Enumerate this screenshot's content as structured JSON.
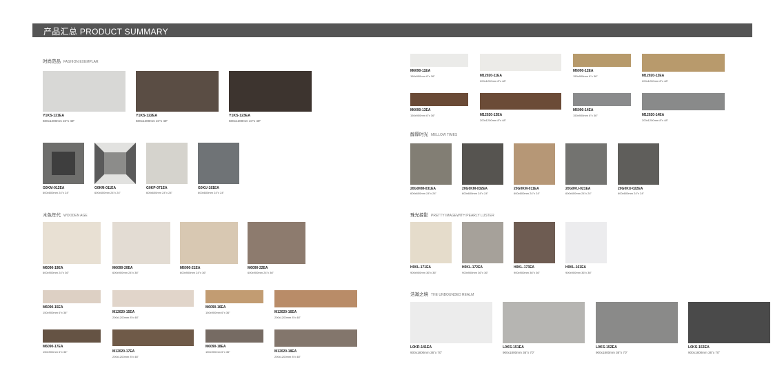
{
  "header": {
    "title": "产品汇总 PRODUCT SUMMARY"
  },
  "sections": {
    "fashion": {
      "cn": "时尚范品",
      "en": "FASHION EXEMPLAR"
    },
    "wooden": {
      "cn": "木色年代",
      "en": "WOODEN AGE"
    },
    "mellow": {
      "cn": "醇厚时光",
      "en": "MELLOW TIMES"
    },
    "pearly": {
      "cn": "珠光掠影",
      "en": "PRETTY IMAGEWITH PEARLY LUSTER"
    },
    "realm": {
      "cn": "浩瀚之境",
      "en": "THE UNBOUNDED REALM"
    }
  },
  "tiles": [
    {
      "code": "Y1KS-121EA",
      "size": "600x1200mm 24\"x 48\"",
      "color": "#d8d8d6"
    },
    {
      "code": "Y1KS-122EA",
      "size": "600x1200mm 24\"x 48\"",
      "color": "#5a4d44"
    },
    {
      "code": "Y1KS-123EA",
      "size": "600x1200mm 24\"x 48\"",
      "color": "#3d342f"
    },
    {
      "code": "G0KM-012EA",
      "size": "600x600mm 24\"x 24\"",
      "color": "#6e6e6c"
    },
    {
      "code": "G0KM-011EA",
      "size": "600x600mm 24\"x 24\"",
      "color": "#8c8c8a"
    },
    {
      "code": "G0KP-071EA",
      "size": "600x600mm 24\"x 24\"",
      "color": "#d5d3cd"
    },
    {
      "code": "G0KU-181EA",
      "size": "600x600mm 24\"x 24\"",
      "color": "#6f7376"
    },
    {
      "code": "M6090-19EA",
      "size": "600x900mm 24\"x 36\"",
      "color": "#e8e0d3"
    },
    {
      "code": "M6090-20EA",
      "size": "600x900mm 24\"x 36\"",
      "color": "#e3dcd3"
    },
    {
      "code": "M6090-21EA",
      "size": "600x900mm 24\"x 36\"",
      "color": "#d8c8b2"
    },
    {
      "code": "M6090-22EA",
      "size": "600x900mm 24\"x 36\"",
      "color": "#8d7b6e"
    },
    {
      "code": "M6090-15EA",
      "size": "150x900mm 6\"x 36\"",
      "color": "#ddd0c4"
    },
    {
      "code": "M12020-15EA",
      "size": "200x1200mm 8\"x 48\"",
      "color": "#e1d5ca"
    },
    {
      "code": "M6090-16EA",
      "size": "150x900mm 6\"x 36\"",
      "color": "#c29c72"
    },
    {
      "code": "M12020-16EA",
      "size": "200x1200mm 8\"x 48\"",
      "color": "#b98c68"
    },
    {
      "code": "M6090-17EA",
      "size": "150x900mm 6\"x 36\"",
      "color": "#655344"
    },
    {
      "code": "M12020-17EA",
      "size": "200x1200mm 8\"x 48\"",
      "color": "#6f5a48"
    },
    {
      "code": "M6090-18EA",
      "size": "150x900mm 6\"x 36\"",
      "color": "#766b63"
    },
    {
      "code": "M12020-18EA",
      "size": "200x1200mm 8\"x 48\"",
      "color": "#83766c"
    },
    {
      "code": "M6090-11EA",
      "size": "150x900mm 6\"x 36\"",
      "color": "#ebebe9"
    },
    {
      "code": "M12020-11EA",
      "size": "200x1200mm 8\"x 48\"",
      "color": "#ecebe8"
    },
    {
      "code": "M6090-12EA",
      "size": "150x900mm 6\"x 36\"",
      "color": "#b79a6b"
    },
    {
      "code": "M12020-12EA",
      "size": "200x1200mm 8\"x 48\"",
      "color": "#b89a6c"
    },
    {
      "code": "M6090-13EA",
      "size": "150x900mm 6\"x 36\"",
      "color": "#6a4a36"
    },
    {
      "code": "M12020-13EA",
      "size": "200x1200mm 8\"x 48\"",
      "color": "#6b4b37"
    },
    {
      "code": "M6090-14EA",
      "size": "150x900mm 6\"x 36\"",
      "color": "#8a8b8c"
    },
    {
      "code": "M12020-14EA",
      "size": "200x1200mm 8\"x 48\"",
      "color": "#898a8a"
    },
    {
      "code": "20G0KM-031EA",
      "size": "600x600mm 24\"x 24\"",
      "color": "#827e74"
    },
    {
      "code": "20G0KM-032EA",
      "size": "600x600mm 24\"x 24\"",
      "color": "#565450"
    },
    {
      "code": "20G0KM-011EA",
      "size": "600x600mm 24\"x 24\"",
      "color": "#b69776"
    },
    {
      "code": "20G0KU-021EA",
      "size": "600x600mm 24\"x 24\"",
      "color": "#737370"
    },
    {
      "code": "20G0KU-022EA",
      "size": "600x600mm 24\"x 24\"",
      "color": "#5f5e5b"
    },
    {
      "code": "H0KL-171EA",
      "size": "900x900mm 36\"x 36\"",
      "color": "#e5dccb"
    },
    {
      "code": "H0KL-172EA",
      "size": "900x900mm 36\"x 36\"",
      "color": "#a6a19a"
    },
    {
      "code": "H0KL-173EA",
      "size": "900x900mm 36\"x 36\"",
      "color": "#6e5c52"
    },
    {
      "code": "H0KL-161EA",
      "size": "900x900mm 36\"x 36\"",
      "color": "#ececee"
    },
    {
      "code": "L0KR-141EA",
      "size": "900x1800mm 36\"x 70\"",
      "color": "#ececec"
    },
    {
      "code": "L0KS-151EA",
      "size": "900x1800mm 36\"x 70\"",
      "color": "#b6b5b2"
    },
    {
      "code": "L0KS-152EA",
      "size": "900x1800mm 36\"x 70\"",
      "color": "#8a8a89"
    },
    {
      "code": "L0KS-153EA",
      "size": "900x1800mm 36\"x 70\"",
      "color": "#4a4a4a"
    }
  ]
}
